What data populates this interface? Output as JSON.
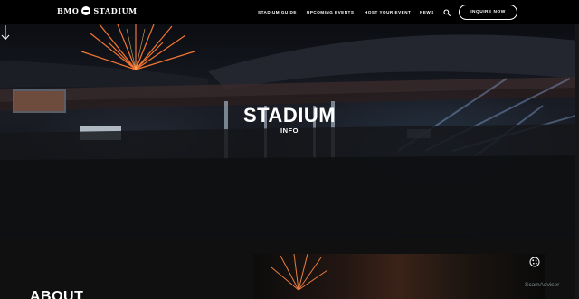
{
  "header": {
    "logo_text_left": "BMO",
    "logo_text_right": "STADIUM",
    "nav": [
      "STADIUM GUIDE",
      "UPCOMING EVENTS",
      "HOST YOUR EVENT",
      "NEWS"
    ],
    "cta_label": "INQUIRE NOW",
    "search_icon": "search-icon"
  },
  "hero": {
    "title": "STADIUM",
    "subtitle": "INFO",
    "scroll_icon": "arrow-down-icon"
  },
  "about": {
    "heading": "ABOUT"
  },
  "watermark": "ScamAdviser",
  "colors": {
    "background": "#000000",
    "text": "#ffffff",
    "firework": "#ff6a2a"
  }
}
